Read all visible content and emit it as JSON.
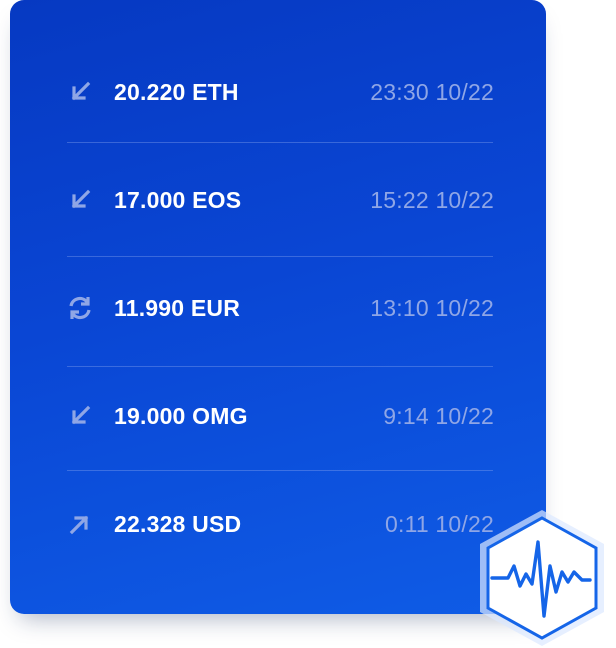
{
  "transactions": [
    {
      "type": "receive",
      "icon": "arrow-down-left-icon",
      "amount": "20.220 ETH",
      "time": "23:30 10/22"
    },
    {
      "type": "receive",
      "icon": "arrow-down-left-icon",
      "amount": "17.000 EOS",
      "time": "15:22 10/22"
    },
    {
      "type": "exchange",
      "icon": "refresh-icon",
      "amount": "11.990 EUR",
      "time": "13:10 10/22"
    },
    {
      "type": "receive",
      "icon": "arrow-down-left-icon",
      "amount": "19.000 OMG",
      "time": "9:14 10/22"
    },
    {
      "type": "send",
      "icon": "arrow-up-right-icon",
      "amount": "22.328 USD",
      "time": "0:11 10/22"
    }
  ],
  "badge": {
    "icon": "pulse-icon"
  },
  "colors": {
    "card_start": "#0639c2",
    "card_end": "#0f5ce6",
    "icon": "#8fa6e6",
    "amount": "#ffffff",
    "time": "#8fa6e6",
    "badge_stroke": "#1565e8"
  }
}
